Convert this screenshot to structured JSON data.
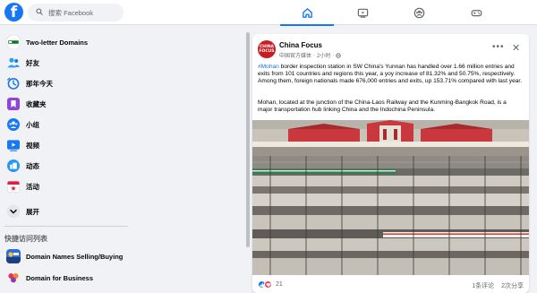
{
  "search": {
    "placeholder": "搜索 Facebook"
  },
  "nav": {
    "tabs": [
      {
        "name": "home",
        "active": true
      },
      {
        "name": "watch",
        "active": false
      },
      {
        "name": "groups",
        "active": false
      },
      {
        "name": "gaming",
        "active": false
      }
    ]
  },
  "sidebar": {
    "items": [
      {
        "label": "Two-letter Domains",
        "icon": "two-letter-domains-thumb"
      },
      {
        "label": "好友",
        "icon": "friends-icon"
      },
      {
        "label": "那年今天",
        "icon": "memories-icon"
      },
      {
        "label": "收藏夹",
        "icon": "saved-icon"
      },
      {
        "label": "小组",
        "icon": "groups-icon"
      },
      {
        "label": "视频",
        "icon": "video-icon"
      },
      {
        "label": "动态",
        "icon": "feeds-icon"
      },
      {
        "label": "活动",
        "icon": "events-icon"
      },
      {
        "label": "展开",
        "icon": "chevron-down-icon"
      }
    ],
    "shortcuts_title": "快捷访问列表",
    "shortcuts": [
      {
        "label": "Domain Names Selling/Buying"
      },
      {
        "label": "Domain for Business"
      }
    ]
  },
  "post": {
    "page_name": "China Focus",
    "avatar_text": [
      "CHINA",
      "FOCUS"
    ],
    "subtitle": "中国官方媒体",
    "separator": "·",
    "time": "2小时",
    "hashtag": "#Mohan",
    "paragraph1": " border inspection station in SW China's Yunnan has handled over 1.66 million entries and exits from 101 countries and regions this year, a yoy increase of 81.32% and 50.75%, respectively. Among them, foreign nationals made 676,000 entries and exits, up 153.71% compared with last year.",
    "paragraph2": "Mohan, located at the junction of the China-Laos Railway and the Kunming-Bangkok Road, is a major transportation hub linking China and the Indochina Peninsula.",
    "reaction_count": "21",
    "comments": "1条评论",
    "shares": "2次分享"
  },
  "colors": {
    "brand": "#1877f2",
    "like": "#1877f2",
    "love": "#f33e58",
    "hashtag": "#216fdb"
  }
}
